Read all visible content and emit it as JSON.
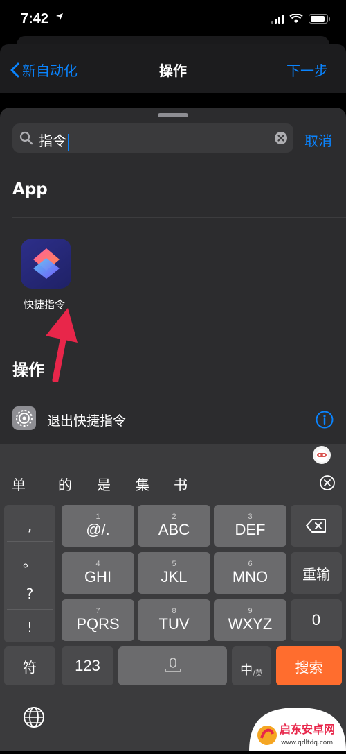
{
  "status_bar": {
    "time": "7:42"
  },
  "nav": {
    "back_label": "新自动化",
    "title": "操作",
    "next_label": "下一步"
  },
  "search": {
    "query": "指令",
    "cancel_label": "取消"
  },
  "sections": {
    "app_title": "App",
    "app_item": {
      "label": "快捷指令",
      "icon": "shortcuts-app-icon"
    },
    "actions_title": "操作",
    "action_item": {
      "label": "退出快捷指令",
      "icon": "gear-icon"
    }
  },
  "keyboard": {
    "candidates": [
      "单",
      "的",
      "是",
      "集",
      "书"
    ],
    "punctuation": [
      ",",
      "。",
      "?",
      "!"
    ],
    "rows": [
      [
        {
          "main": "@/.",
          "sub": "1"
        },
        {
          "main": "ABC",
          "sub": "2"
        },
        {
          "main": "DEF",
          "sub": "3"
        }
      ],
      [
        {
          "main": "GHI",
          "sub": "4"
        },
        {
          "main": "JKL",
          "sub": "5"
        },
        {
          "main": "MNO",
          "sub": "6"
        }
      ],
      [
        {
          "main": "PQRS",
          "sub": "7"
        },
        {
          "main": "TUV",
          "sub": "8"
        },
        {
          "main": "WXYZ",
          "sub": "9"
        }
      ]
    ],
    "right_keys": {
      "retype": "重输",
      "zero": "0"
    },
    "bottom": {
      "symbol": "符",
      "numbers": "123",
      "lang_main": "中",
      "lang_sub": "/英",
      "search": "搜索"
    }
  },
  "watermark": {
    "name": "启东安卓网",
    "url": "www.qdltdq.com"
  },
  "colors": {
    "accent": "#0a84ff",
    "search_key": "#ff6d2e",
    "annotation_arrow": "#e8264a"
  }
}
